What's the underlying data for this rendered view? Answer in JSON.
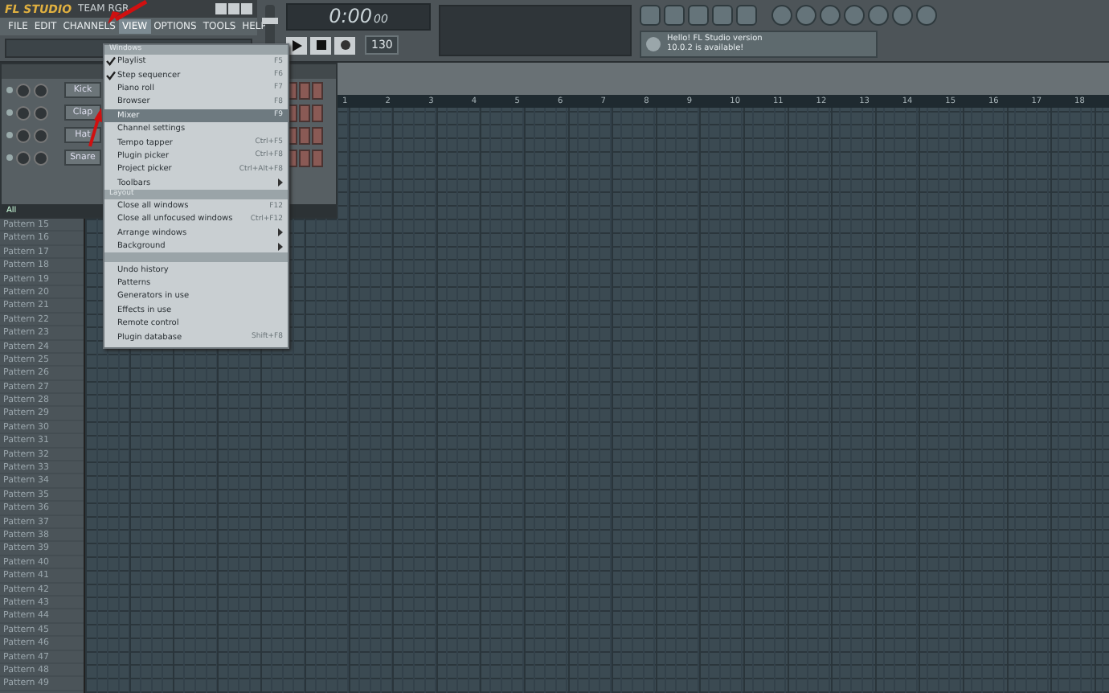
{
  "title_bar": {
    "logo": "FL STUDIO",
    "user": "TEAM RGR"
  },
  "menu": [
    {
      "label": "FILE",
      "selected": false
    },
    {
      "label": "EDIT",
      "selected": false
    },
    {
      "label": "CHANNELS",
      "selected": false
    },
    {
      "label": "VIEW",
      "selected": true
    },
    {
      "label": "OPTIONS",
      "selected": false
    },
    {
      "label": "TOOLS",
      "selected": false
    },
    {
      "label": "HELP",
      "selected": false
    }
  ],
  "master_volume": {
    "level": 0.7
  },
  "transport": {
    "time_main": "0:00",
    "time_small": "00",
    "tempo": "130"
  },
  "news": {
    "lines": [
      "Hello! FL Studio version",
      "10.0.2 is available!"
    ]
  },
  "channel_rack": {
    "channels": [
      {
        "name": "Kick"
      },
      {
        "name": "Clap"
      },
      {
        "name": "Hat"
      },
      {
        "name": "Snare"
      }
    ],
    "filter": "All"
  },
  "view_menu": {
    "sections": [
      {
        "header": "Windows",
        "items": [
          {
            "label": "Playlist",
            "shortcut": "F5",
            "checked": true,
            "selected": false,
            "submenu": false
          },
          {
            "label": "Step sequencer",
            "shortcut": "F6",
            "checked": true,
            "selected": false,
            "submenu": false
          },
          {
            "label": "Piano roll",
            "shortcut": "F7",
            "checked": false,
            "selected": false,
            "submenu": false
          },
          {
            "label": "Browser",
            "shortcut": "F8",
            "checked": false,
            "selected": false,
            "submenu": false
          },
          {
            "label": "Mixer",
            "shortcut": "F9",
            "checked": false,
            "selected": true,
            "submenu": false
          },
          {
            "label": "Channel settings",
            "checked": false,
            "selected": false,
            "submenu": false
          },
          {
            "label": "Tempo tapper",
            "shortcut": "Ctrl+F5",
            "checked": false,
            "selected": false,
            "submenu": false
          },
          {
            "label": "Plugin picker",
            "shortcut": "Ctrl+F8",
            "checked": false,
            "selected": false,
            "submenu": false
          },
          {
            "label": "Project picker",
            "shortcut": "Ctrl+Alt+F8",
            "checked": false,
            "selected": false,
            "submenu": false
          },
          {
            "label": "Toolbars",
            "checked": false,
            "selected": false,
            "submenu": true
          }
        ]
      },
      {
        "header": "Layout",
        "items": [
          {
            "label": "Close all windows",
            "shortcut": "F12",
            "checked": false,
            "selected": false,
            "submenu": false
          },
          {
            "label": "Close all unfocused windows",
            "shortcut": "Ctrl+F12",
            "checked": false,
            "selected": false,
            "submenu": false
          },
          {
            "label": "Arrange windows",
            "checked": false,
            "selected": false,
            "submenu": true
          },
          {
            "label": "Background",
            "checked": false,
            "selected": false,
            "submenu": true
          }
        ]
      },
      {
        "items": [
          {
            "label": "Undo history",
            "checked": false,
            "selected": false,
            "submenu": false
          },
          {
            "label": "Patterns",
            "checked": false,
            "selected": false,
            "submenu": false
          },
          {
            "label": "Generators in use",
            "checked": false,
            "selected": false,
            "submenu": false
          },
          {
            "label": "Effects in use",
            "checked": false,
            "selected": false,
            "submenu": false
          },
          {
            "label": "Remote control",
            "checked": false,
            "selected": false,
            "submenu": false
          },
          {
            "label": "Plugin database",
            "shortcut": "Shift+F8",
            "checked": false,
            "selected": false,
            "submenu": false
          }
        ]
      }
    ]
  },
  "ruler": [
    "1",
    "2",
    "3",
    "4",
    "5",
    "6",
    "7",
    "8",
    "9",
    "10",
    "11",
    "12",
    "13",
    "14",
    "15",
    "16",
    "17",
    "18"
  ],
  "patterns": [
    "Pattern 15",
    "Pattern 16",
    "Pattern 17",
    "Pattern 18",
    "Pattern 19",
    "Pattern 20",
    "Pattern 21",
    "Pattern 22",
    "Pattern 23",
    "Pattern 24",
    "Pattern 25",
    "Pattern 26",
    "Pattern 27",
    "Pattern 28",
    "Pattern 29",
    "Pattern 30",
    "Pattern 31",
    "Pattern 32",
    "Pattern 33",
    "Pattern 34",
    "Pattern 35",
    "Pattern 36",
    "Pattern 37",
    "Pattern 38",
    "Pattern 39",
    "Pattern 40",
    "Pattern 41",
    "Pattern 42",
    "Pattern 43",
    "Pattern 44",
    "Pattern 45",
    "Pattern 46",
    "Pattern 47",
    "Pattern 48",
    "Pattern 49"
  ]
}
